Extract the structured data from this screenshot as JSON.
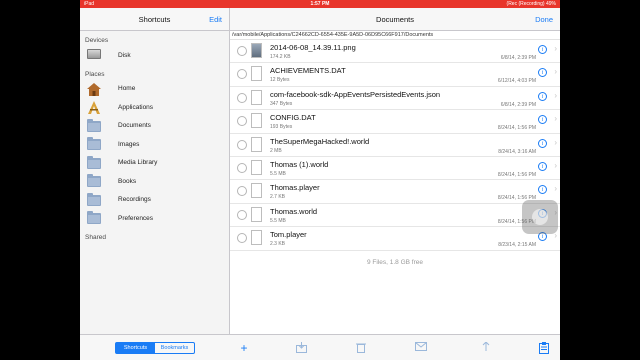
{
  "status_bar": {
    "carrier": "iPad",
    "time": "1:57 PM",
    "right": "(Rec (Recording)  49%"
  },
  "left_pane": {
    "title": "Shortcuts",
    "edit_label": "Edit",
    "devices_header": "Devices",
    "devices": [
      {
        "label": "Disk",
        "icon": "disk-icon"
      }
    ],
    "places_header": "Places",
    "places": [
      {
        "label": "Home",
        "icon": "home-icon"
      },
      {
        "label": "Applications",
        "icon": "applications-icon"
      },
      {
        "label": "Documents",
        "icon": "folder-icon"
      },
      {
        "label": "Images",
        "icon": "folder-icon"
      },
      {
        "label": "Media Library",
        "icon": "folder-icon"
      },
      {
        "label": "Books",
        "icon": "folder-icon"
      },
      {
        "label": "Recordings",
        "icon": "folder-icon"
      },
      {
        "label": "Preferences",
        "icon": "folder-icon"
      }
    ],
    "shared_header": "Shared",
    "segments": [
      "Shortcuts",
      "Bookmarks"
    ]
  },
  "right_pane": {
    "title": "Documents",
    "done_label": "Done",
    "path": "/var/mobile/Applications/C24662CD-6554-435E-9A5D-06D95C66F917/Documents",
    "files": [
      {
        "name": "2014-06-08_14.39.11.png",
        "size": "174.2 KB",
        "date": "6/8/14, 2:39 PM",
        "icon": "image-file-icon"
      },
      {
        "name": "ACHIEVEMENTS.DAT",
        "size": "12 Bytes",
        "date": "6/12/14, 4:03 PM",
        "icon": "file-icon"
      },
      {
        "name": "com-facebook-sdk-AppEventsPersistedEvents.json",
        "size": "347 Bytes",
        "date": "6/8/14, 2:39 PM",
        "icon": "file-icon"
      },
      {
        "name": "CONFIG.DAT",
        "size": "193 Bytes",
        "date": "8/24/14, 1:56 PM",
        "icon": "file-icon"
      },
      {
        "name": "TheSuperMegaHacked!.world",
        "size": "2 MB",
        "date": "8/24/14, 3:16 AM",
        "icon": "file-icon"
      },
      {
        "name": "Thomas (1).world",
        "size": "5.5 MB",
        "date": "8/24/14, 1:56 PM",
        "icon": "file-icon"
      },
      {
        "name": "Thomas.player",
        "size": "2.7 KB",
        "date": "8/24/14, 1:56 PM",
        "icon": "file-icon"
      },
      {
        "name": "Thomas.world",
        "size": "5.5 MB",
        "date": "8/24/14, 1:56 PM",
        "icon": "file-icon"
      },
      {
        "name": "Tom.player",
        "size": "2.3 KB",
        "date": "8/23/14, 2:15 AM",
        "icon": "file-icon"
      }
    ],
    "summary": "9 Files, 1.8 GB free",
    "toolbar": [
      "add-icon",
      "move-icon",
      "delete-icon",
      "mail-icon",
      "share-icon",
      "clipboard-icon"
    ]
  },
  "colors": {
    "accent": "#1a7cf5",
    "status_bar": "#e8352b"
  }
}
